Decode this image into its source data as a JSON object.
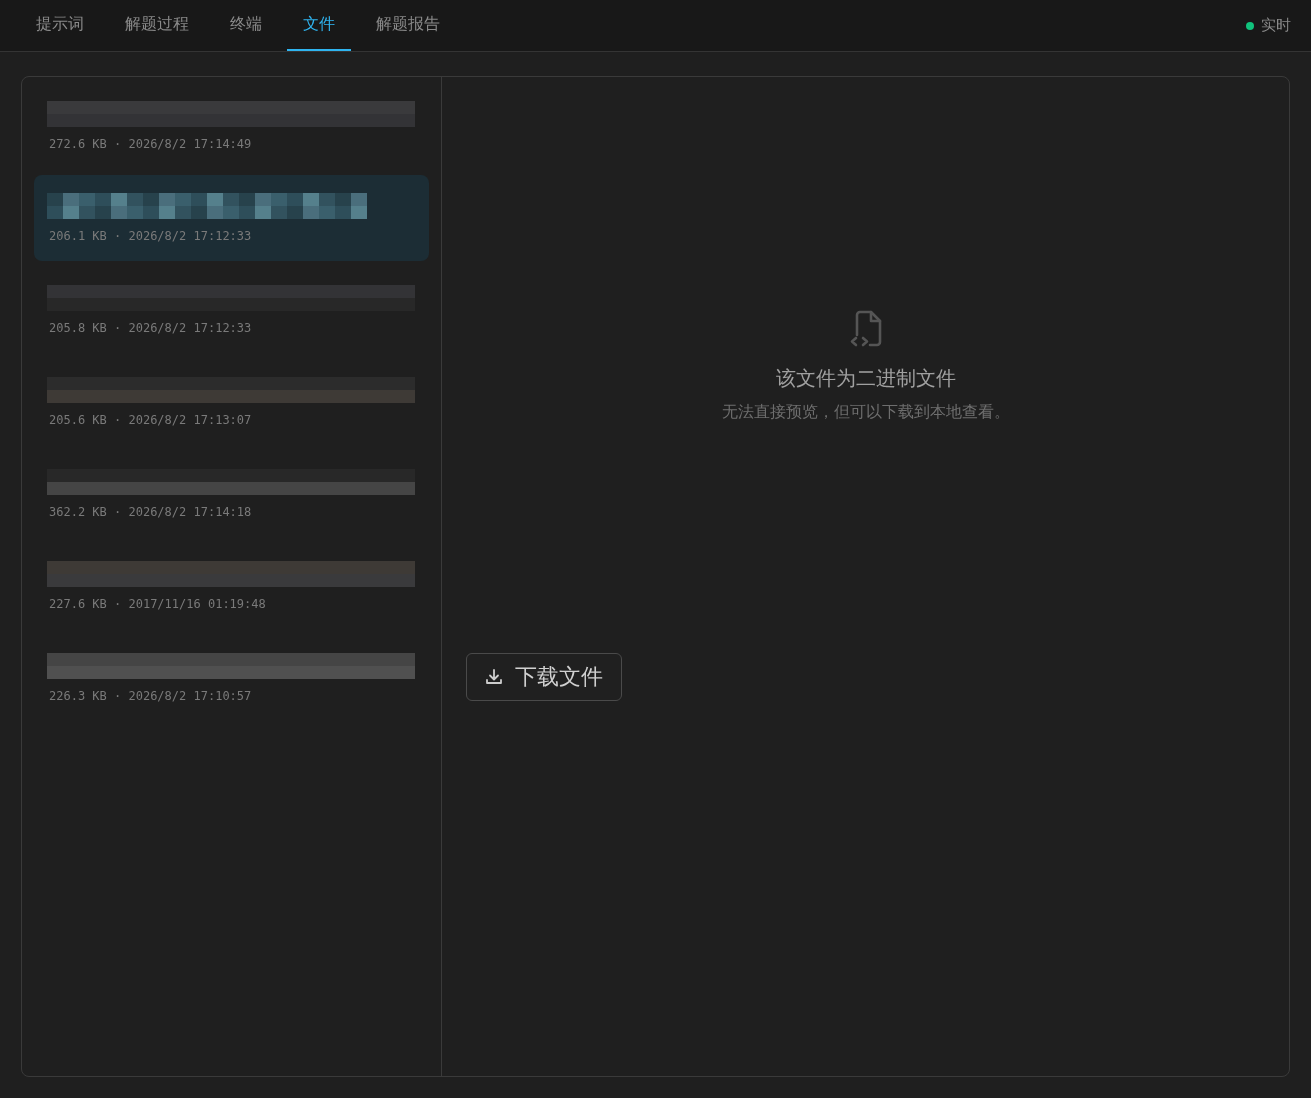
{
  "tabs": [
    {
      "label": "提示词",
      "selected": false
    },
    {
      "label": "解题过程",
      "selected": false
    },
    {
      "label": "终端",
      "selected": false
    },
    {
      "label": "文件",
      "selected": true
    },
    {
      "label": "解题报告",
      "selected": false
    }
  ],
  "live": {
    "label": "实时",
    "color": "#10c27c"
  },
  "files": [
    {
      "meta": "272.6 KB · 2026/8/2 17:14:49",
      "selected": false
    },
    {
      "meta": "206.1 KB · 2026/8/2 17:12:33",
      "selected": true
    },
    {
      "meta": "205.8 KB · 2026/8/2 17:12:33",
      "selected": false
    },
    {
      "meta": "205.6 KB · 2026/8/2 17:13:07",
      "selected": false
    },
    {
      "meta": "362.2 KB · 2026/8/2 17:14:18",
      "selected": false
    },
    {
      "meta": "227.6 KB · 2017/11/16 01:19:48",
      "selected": false
    },
    {
      "meta": "226.3 KB · 2026/8/2 17:10:57",
      "selected": false
    }
  ],
  "preview": {
    "title": "该文件为二进制文件",
    "subtitle": "无法直接预览，但可以下载到本地查看。"
  },
  "download_button": "下载文件"
}
